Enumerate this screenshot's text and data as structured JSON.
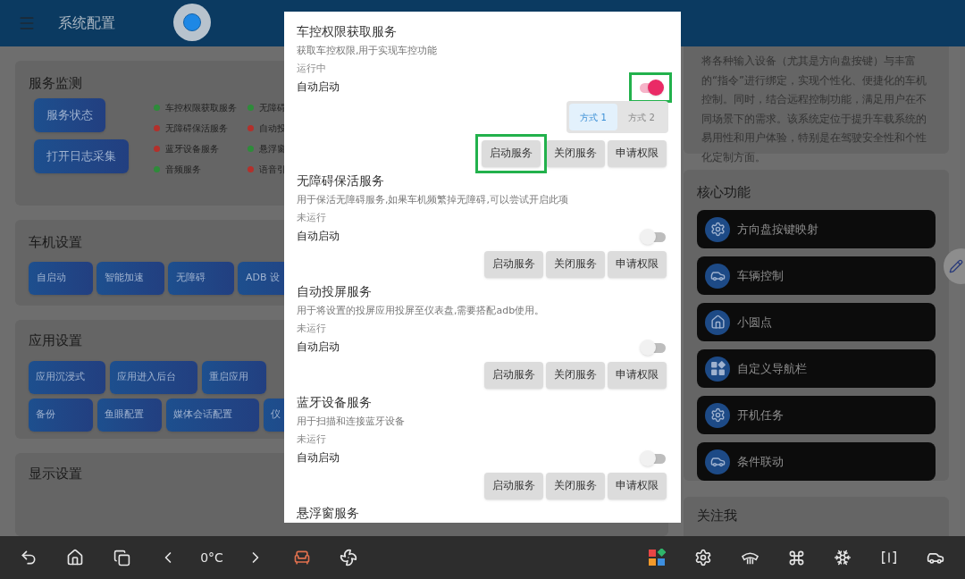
{
  "app_bar": {
    "title": "系统配置"
  },
  "service_monitor": {
    "title": "服务监测",
    "buttons": [
      "服务状态",
      "打开日志采集"
    ],
    "statuses": [
      {
        "label": "车控权限获取服务",
        "color": "#2e8b3a"
      },
      {
        "label": "无障碍",
        "color": "#2e8b3a"
      },
      {
        "label": "无障碍保活服务",
        "color": "#b3302b"
      },
      {
        "label": "自动投",
        "color": "#b3302b"
      },
      {
        "label": "蓝牙设备服务",
        "color": "#b3302b"
      },
      {
        "label": "悬浮窗",
        "color": "#2e8b3a"
      },
      {
        "label": "音频服务",
        "color": "#2e8b3a"
      },
      {
        "label": "语音引",
        "color": "#b3302b"
      }
    ]
  },
  "head_unit": {
    "title": "车机设置",
    "buttons": [
      "自启动",
      "智能加速",
      "无障碍",
      "ADB 设"
    ]
  },
  "app_settings": {
    "title": "应用设置",
    "rows": [
      [
        "应用沉浸式",
        "应用进入后台",
        "重启应用"
      ],
      [
        "备份",
        "鱼眼配置",
        "媒体会话配置",
        "仪"
      ]
    ]
  },
  "display_settings": {
    "title": "显示设置"
  },
  "about": {
    "text": "将各种输入设备（尤其是方向盘按键）与丰富的“指令”进行绑定，实现个性化、便捷化的车机控制。同时，结合远程控制功能，满足用户在不同场景下的需求。该系统定位于提升车载系统的易用性和用户体验，特别是在驾驶安全性和个性化定制方面。"
  },
  "core_functions": {
    "title": "核心功能",
    "items": [
      {
        "label": "方向盘按键映射",
        "kind": "gear"
      },
      {
        "label": "车辆控制",
        "kind": "car"
      },
      {
        "label": "小圆点",
        "kind": "home"
      },
      {
        "label": "自定义导航栏",
        "kind": "apps"
      },
      {
        "label": "开机任务",
        "kind": "gear"
      },
      {
        "label": "条件联动",
        "kind": "car"
      }
    ]
  },
  "follow": {
    "title": "关注我"
  },
  "dialog": {
    "services": [
      {
        "title": "车控权限获取服务",
        "description": "获取车控权限,用于实现车控功能",
        "status": "运行中",
        "auto_start_label": "自动启动",
        "auto_start": true,
        "auto_start_highlighted": true,
        "modes": [
          {
            "label": "方式 1",
            "selected": true
          },
          {
            "label": "方式 2",
            "selected": false
          }
        ],
        "buttons": [
          {
            "label": "启动服务",
            "highlighted": true
          },
          {
            "label": "关闭服务",
            "highlighted": false
          },
          {
            "label": "申请权限",
            "highlighted": false
          }
        ]
      },
      {
        "title": "无障碍保活服务",
        "description": "用于保活无障碍服务,如果车机频繁掉无障碍,可以尝试开启此项",
        "status": "未运行",
        "auto_start_label": "自动启动",
        "auto_start": false,
        "auto_start_highlighted": false,
        "buttons": [
          {
            "label": "启动服务",
            "highlighted": false
          },
          {
            "label": "关闭服务",
            "highlighted": false
          },
          {
            "label": "申请权限",
            "highlighted": false
          }
        ]
      },
      {
        "title": "自动投屏服务",
        "description": "用于将设置的投屏应用投屏至仪表盘,需要搭配adb使用。",
        "status": "未运行",
        "auto_start_label": "自动启动",
        "auto_start": false,
        "auto_start_highlighted": false,
        "buttons": [
          {
            "label": "启动服务",
            "highlighted": false
          },
          {
            "label": "关闭服务",
            "highlighted": false
          },
          {
            "label": "申请权限",
            "highlighted": false
          }
        ]
      },
      {
        "title": "蓝牙设备服务",
        "description": "用于扫描和连接蓝牙设备",
        "status": "未运行",
        "auto_start_label": "自动启动",
        "auto_start": false,
        "auto_start_highlighted": false,
        "buttons": [
          {
            "label": "启动服务",
            "highlighted": false
          },
          {
            "label": "关闭服务",
            "highlighted": false
          },
          {
            "label": "申请权限",
            "highlighted": false
          }
        ]
      },
      {
        "title": "悬浮窗服务"
      }
    ]
  },
  "nav_bar": {
    "temperature": "0°C"
  }
}
